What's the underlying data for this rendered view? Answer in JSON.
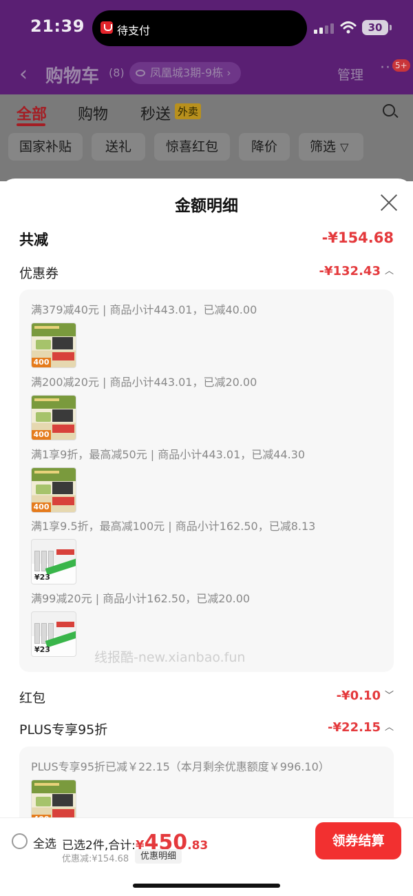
{
  "status_bar": {
    "time": "21:39",
    "live_activity": "待支付",
    "battery": "30"
  },
  "nav": {
    "back_icon": "chevron-left",
    "title": "购物车",
    "count": "(8)",
    "address": "凤凰城3期-9栋",
    "address_chevron": "›",
    "manage": "管理",
    "more": "···",
    "badge": "5+"
  },
  "tabs": {
    "items": [
      "全部",
      "购物",
      "秒送"
    ],
    "active": "全部",
    "tag": "外卖"
  },
  "chips": [
    "国家补贴",
    "送礼",
    "惊喜红包",
    "降价",
    "筛选"
  ],
  "sheet": {
    "title": "金额明细",
    "total_label": "共减",
    "total_value": "-¥154.68",
    "coupon_label": "优惠券",
    "coupon_value": "-¥132.43",
    "coupon_chevron": "︿",
    "coupons": [
      {
        "text": "满379减40元 | 商品小计443.01，已减40.00",
        "thumb": "green"
      },
      {
        "text": "满200减20元 | 商品小计443.01，已减20.00",
        "thumb": "green"
      },
      {
        "text": "满1享9折，最高减50元 | 商品小计443.01，已减44.30",
        "thumb": "green"
      },
      {
        "text": "满1享9.5折，最高减100元 | 商品小计162.50，已减8.13",
        "thumb": "grey"
      },
      {
        "text": "满99减20元 | 商品小计162.50，已减20.00",
        "thumb": "grey"
      }
    ],
    "thumb_text": {
      "green_price": "400",
      "grey_price": "¥23"
    },
    "watermark": "线报酷-new.xianbao.fun",
    "redpacket_label": "红包",
    "redpacket_value": "-¥0.10",
    "redpacket_chevron": "﹀",
    "plus_label": "PLUS专享95折",
    "plus_value": "-¥22.15",
    "plus_chevron": "︿",
    "plus_detail": "PLUS专享95折已减￥22.15（本月剩余优惠额度￥996.10）"
  },
  "bottom": {
    "select_all": "全选",
    "selected": "已选2件,合计:",
    "currency": "¥",
    "amount_int": "450",
    "amount_dec": ".83",
    "saved": "优惠减:¥154.68",
    "detail_button": "优惠明细",
    "checkout": "领券结算"
  }
}
